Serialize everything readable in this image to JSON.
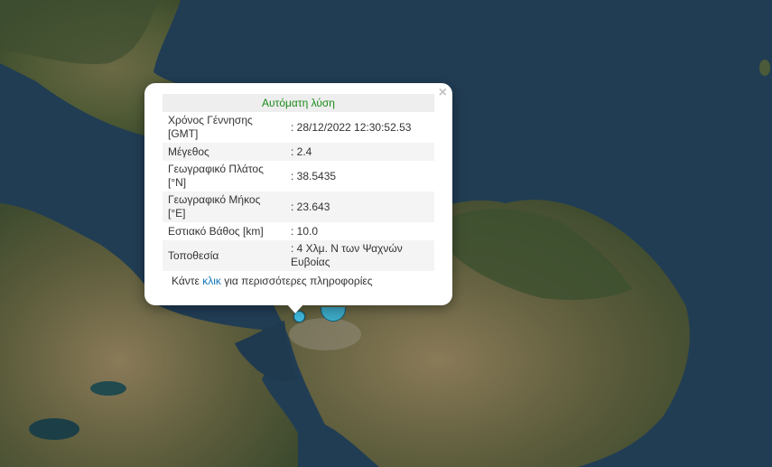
{
  "popup": {
    "title": "Αυτόματη λύση",
    "close_label": "×",
    "rows": [
      {
        "label": "Χρόνος Γέννησης [GMT]",
        "value": ": 28/12/2022 12:30:52.53"
      },
      {
        "label": "Μέγεθος",
        "value": ": 2.4"
      },
      {
        "label": "Γεωγραφικό Πλάτος [°N]",
        "value": ": 38.5435"
      },
      {
        "label": "Γεωγραφικό Μήκος [°E]",
        "value": ": 23.643"
      },
      {
        "label": "Εστιακό Βάθος [km]",
        "value": ": 10.0"
      },
      {
        "label": "Τοποθεσία",
        "value": ": 4 Χλμ. N των Ψαχνών Ευβοίας"
      }
    ],
    "footer": {
      "prefix": "Κάντε ",
      "link": "κλικ",
      "suffix": " για περισσότερες πληροφορίες"
    }
  },
  "colors": {
    "sea": "#1f3a4f",
    "title_green": "#1a8a1a",
    "link_blue": "#1577b8",
    "marker": "#3fb6d9"
  }
}
